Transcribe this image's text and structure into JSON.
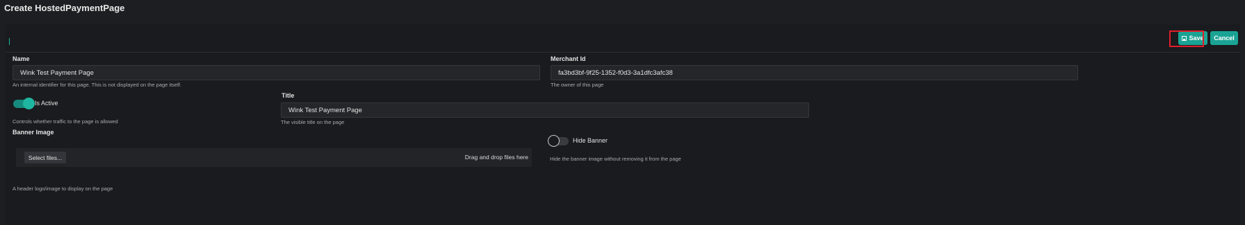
{
  "page": {
    "title": "Create HostedPaymentPage"
  },
  "toolbar": {
    "save_label": "Save",
    "cancel_label": "Cancel",
    "save_icon": "save-icon"
  },
  "form": {
    "name": {
      "label": "Name",
      "value": "Wink Test Payment Page",
      "hint": "An internal identifier for this page. This is not displayed on the page itself."
    },
    "merchant_id": {
      "label": "Merchant Id",
      "value": "fa3bd3bf-9f25-1352-f0d3-3a1dfc3afc38",
      "hint": "The owner of this page"
    },
    "is_active": {
      "label": "Is Active",
      "checked": true,
      "hint": "Controls whether traffic to the page is allowed"
    },
    "title": {
      "label": "Title",
      "value": "Wink Test Payment Page",
      "hint": "The visible title on the page"
    },
    "banner_image": {
      "label": "Banner Image",
      "select_label": "Select files...",
      "drop_hint": "Drag and drop files here",
      "hint": "A header logo/image to display on the page"
    },
    "hide_banner": {
      "label": "Hide Banner",
      "checked": false,
      "hint": "Hide the banner image without removing it from the page"
    }
  },
  "colors": {
    "accent": "#1aa394",
    "highlight": "#e11d2a",
    "background": "#1d1e22"
  }
}
